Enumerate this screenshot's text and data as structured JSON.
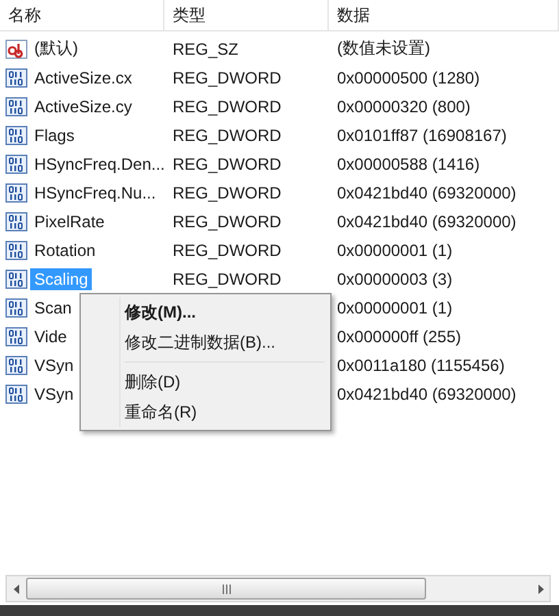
{
  "columns": [
    "名称",
    "类型",
    "数据"
  ],
  "rows": [
    {
      "kind": "string",
      "name": "(默认)",
      "type": "REG_SZ",
      "data": "(数值未设置)",
      "selected": false
    },
    {
      "kind": "binary",
      "name": "ActiveSize.cx",
      "type": "REG_DWORD",
      "data": "0x00000500 (1280)",
      "selected": false
    },
    {
      "kind": "binary",
      "name": "ActiveSize.cy",
      "type": "REG_DWORD",
      "data": "0x00000320 (800)",
      "selected": false
    },
    {
      "kind": "binary",
      "name": "Flags",
      "type": "REG_DWORD",
      "data": "0x0101ff87 (16908167)",
      "selected": false
    },
    {
      "kind": "binary",
      "name": "HSyncFreq.Den...",
      "type": "REG_DWORD",
      "data": "0x00000588 (1416)",
      "selected": false
    },
    {
      "kind": "binary",
      "name": "HSyncFreq.Nu...",
      "type": "REG_DWORD",
      "data": "0x0421bd40 (69320000)",
      "selected": false
    },
    {
      "kind": "binary",
      "name": "PixelRate",
      "type": "REG_DWORD",
      "data": "0x0421bd40 (69320000)",
      "selected": false
    },
    {
      "kind": "binary",
      "name": "Rotation",
      "type": "REG_DWORD",
      "data": "0x00000001 (1)",
      "selected": false
    },
    {
      "kind": "binary",
      "name": "Scaling",
      "type": "REG_DWORD",
      "data": "0x00000003 (3)",
      "selected": true
    },
    {
      "kind": "binary",
      "name": "Scan",
      "data": "0x00000001 (1)",
      "selected": false
    },
    {
      "kind": "binary",
      "name": "Vide",
      "data": "0x000000ff (255)",
      "selected": false
    },
    {
      "kind": "binary",
      "name": "VSyn",
      "data": "0x0011a180 (1155456)",
      "selected": false
    },
    {
      "kind": "binary",
      "name": "VSyn",
      "data": "0x0421bd40 (69320000)",
      "selected": false
    }
  ],
  "context_menu": [
    {
      "kind": "item",
      "label": "修改(M)...",
      "default": true
    },
    {
      "kind": "item",
      "label": "修改二进制数据(B)...",
      "default": false
    },
    {
      "kind": "separator"
    },
    {
      "kind": "item",
      "label": "删除(D)",
      "default": false
    },
    {
      "kind": "item",
      "label": "重命名(R)",
      "default": false
    }
  ]
}
